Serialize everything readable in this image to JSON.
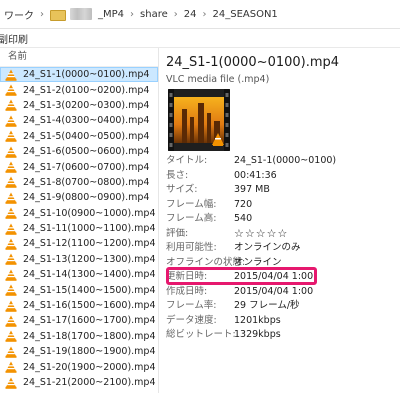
{
  "address": {
    "segments": [
      "ワーク",
      "_MP4",
      "share",
      "24",
      "24_SEASON1"
    ]
  },
  "toolbar": {
    "print_label": "副印刷"
  },
  "file_list": {
    "column_name": "名前",
    "items": [
      "24_S1-1(0000~0100).mp4",
      "24_S1-2(0100~0200).mp4",
      "24_S1-3(0200~0300).mp4",
      "24_S1-4(0300~0400).mp4",
      "24_S1-5(0400~0500).mp4",
      "24_S1-6(0500~0600).mp4",
      "24_S1-7(0600~0700).mp4",
      "24_S1-8(0700~0800).mp4",
      "24_S1-9(0800~0900).mp4",
      "24_S1-10(0900~1000).mp4",
      "24_S1-11(1000~1100).mp4",
      "24_S1-12(1100~1200).mp4",
      "24_S1-13(1200~1300).mp4",
      "24_S1-14(1300~1400).mp4",
      "24_S1-15(1400~1500).mp4",
      "24_S1-16(1500~1600).mp4",
      "24_S1-17(1600~1700).mp4",
      "24_S1-18(1700~1800).mp4",
      "24_S1-19(1800~1900).mp4",
      "24_S1-20(1900~2000).mp4",
      "24_S1-21(2000~2100).mp4"
    ],
    "icon": "vlc-cone-icon"
  },
  "details": {
    "title": "24_S1-1(0000~0100).mp4",
    "type": "VLC media file (.mp4)",
    "properties": [
      {
        "key": "タイトル:",
        "value": "24_S1-1(0000~0100)"
      },
      {
        "key": "長さ:",
        "value": "00:41:36"
      },
      {
        "key": "サイズ:",
        "value": "397 MB"
      },
      {
        "key": "フレーム幅:",
        "value": "720"
      },
      {
        "key": "フレーム高:",
        "value": "540"
      },
      {
        "key": "評価:",
        "value": "☆☆☆☆☆"
      },
      {
        "key": "利用可能性:",
        "value": "オンラインのみ"
      },
      {
        "key": "オフラインの状態:",
        "value": "オンライン"
      },
      {
        "key": "更新日時:",
        "value": "2015/04/04 1:00"
      },
      {
        "key": "作成日時:",
        "value": "2015/04/04 1:00"
      },
      {
        "key": "フレーム率:",
        "value": "29 フレーム/秒"
      },
      {
        "key": "データ速度:",
        "value": "1201kbps"
      },
      {
        "key": "総ビットレート:",
        "value": "1329kbps"
      }
    ]
  },
  "colors": {
    "selection": "#cce8ff",
    "highlight": "#e6186e",
    "vlc_orange": "#f39200"
  }
}
